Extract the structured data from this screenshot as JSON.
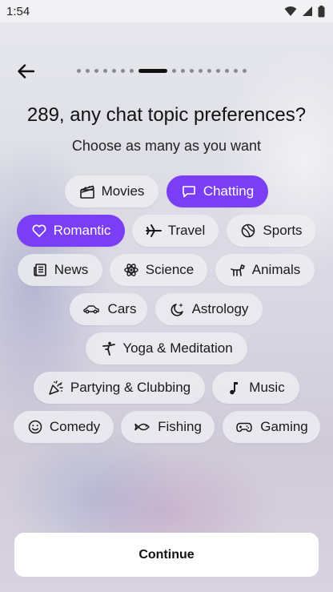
{
  "status": {
    "time": "1:54"
  },
  "title": "289, any chat topic preferences?",
  "subtitle": "Choose as many as you want",
  "progress": {
    "total_steps": 17,
    "current_step": 8
  },
  "topics": [
    {
      "label": "Movies",
      "icon": "clapperboard-icon",
      "selected": false
    },
    {
      "label": "Chatting",
      "icon": "chat-bubble-icon",
      "selected": true
    },
    {
      "label": "Romantic",
      "icon": "heart-icon",
      "selected": true
    },
    {
      "label": "Travel",
      "icon": "airplane-icon",
      "selected": false
    },
    {
      "label": "Sports",
      "icon": "ball-icon",
      "selected": false
    },
    {
      "label": "News",
      "icon": "newspaper-icon",
      "selected": false
    },
    {
      "label": "Science",
      "icon": "atom-icon",
      "selected": false
    },
    {
      "label": "Animals",
      "icon": "dog-icon",
      "selected": false
    },
    {
      "label": "Cars",
      "icon": "car-icon",
      "selected": false
    },
    {
      "label": "Astrology",
      "icon": "moon-star-icon",
      "selected": false
    },
    {
      "label": "Yoga & Meditation",
      "icon": "yoga-icon",
      "selected": false
    },
    {
      "label": "Partying & Clubbing",
      "icon": "party-popper-icon",
      "selected": false
    },
    {
      "label": "Music",
      "icon": "music-note-icon",
      "selected": false
    },
    {
      "label": "Comedy",
      "icon": "smiley-icon",
      "selected": false
    },
    {
      "label": "Fishing",
      "icon": "fish-icon",
      "selected": false
    },
    {
      "label": "Gaming",
      "icon": "gamepad-icon",
      "selected": false
    }
  ],
  "continue_label": "Continue",
  "colors": {
    "accent": "#7a3ff5",
    "text": "#111111"
  }
}
